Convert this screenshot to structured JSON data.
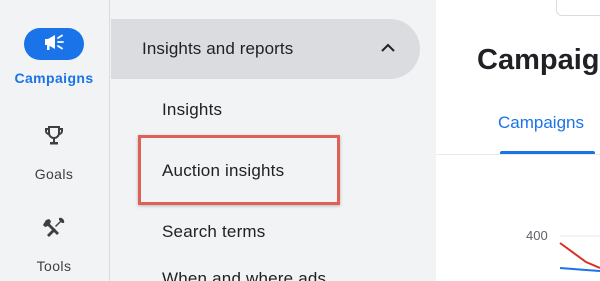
{
  "rail": {
    "items": [
      {
        "label": "Campaigns",
        "icon": "megaphone-icon",
        "active": true
      },
      {
        "label": "Goals",
        "icon": "trophy-icon",
        "active": false
      },
      {
        "label": "Tools",
        "icon": "tools-icon",
        "active": false
      }
    ]
  },
  "menu": {
    "section_title": "Insights and reports",
    "items": [
      "Insights",
      "Auction insights",
      "Search terms",
      "When and where ads"
    ]
  },
  "main": {
    "page_title": "Campaigns",
    "tab_label": "Campaigns",
    "chart_tick": "400"
  },
  "colors": {
    "accent": "#1a73e8",
    "highlight": "#e06055",
    "series_red": "#d93025"
  }
}
